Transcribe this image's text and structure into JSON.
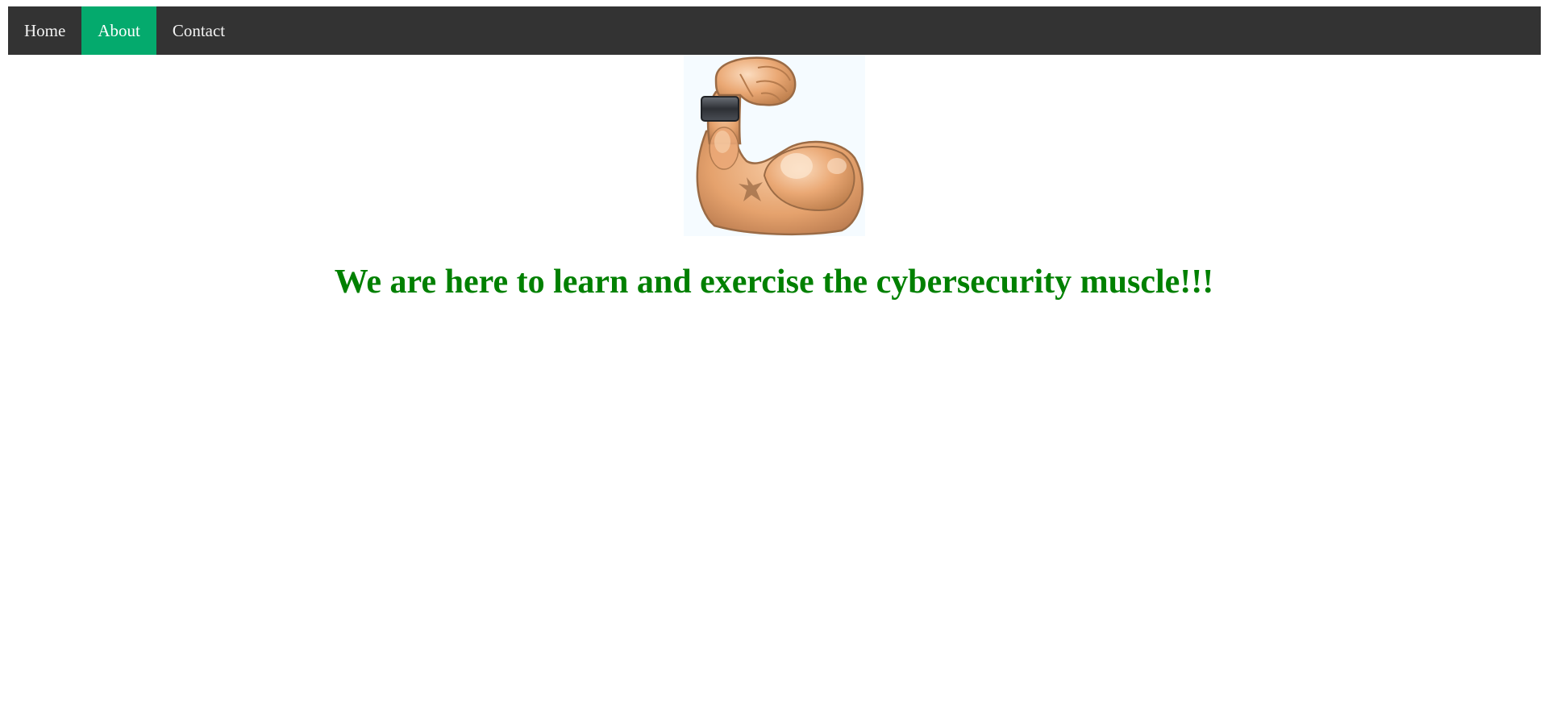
{
  "nav": {
    "items": [
      {
        "label": "Home",
        "active": false
      },
      {
        "label": "About",
        "active": true
      },
      {
        "label": "Contact",
        "active": false
      }
    ],
    "background_color": "#333333",
    "active_color": "#04AA6D"
  },
  "hero": {
    "icon": "flexed-biceps-icon"
  },
  "headline": {
    "text": "We are here to learn and exercise the cybersecurity muscle!!!",
    "color": "#008000"
  }
}
